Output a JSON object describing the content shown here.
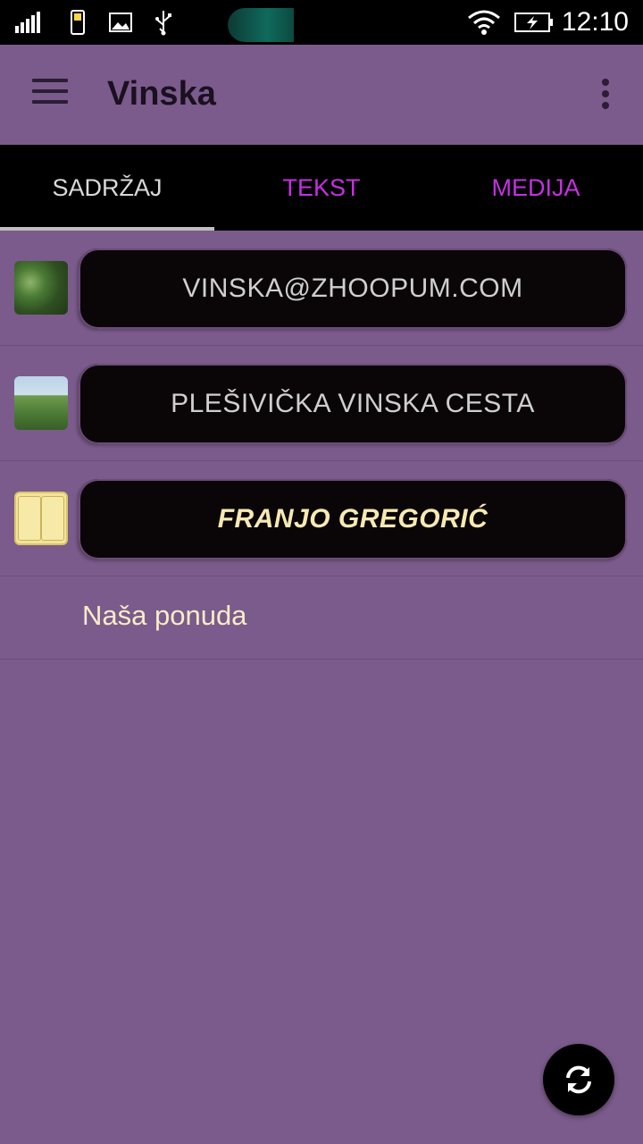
{
  "status_bar": {
    "time": "12:10"
  },
  "app_bar": {
    "title": "Vinska"
  },
  "tabs": [
    {
      "label": "SADRŽAJ",
      "active": true
    },
    {
      "label": "TEKST",
      "active": false
    },
    {
      "label": "MEDIJA",
      "active": false
    }
  ],
  "list": {
    "items": [
      {
        "label": "VINSKA@ZHOOPUM.COM",
        "icon": "grapes-thumbnail"
      },
      {
        "label": "PLEŠIVIČKA VINSKA CESTA",
        "icon": "vineyard-thumbnail"
      },
      {
        "label": "FRANJO GREGORIĆ",
        "icon": "book-icon"
      }
    ],
    "plain_item": "Naša ponuda"
  },
  "fab": {
    "icon": "refresh-icon"
  },
  "colors": {
    "background": "#7b5b8b",
    "tab_active": "#d9d9d9",
    "tab_inactive": "#c72fe3",
    "pill": "#0a0507"
  }
}
